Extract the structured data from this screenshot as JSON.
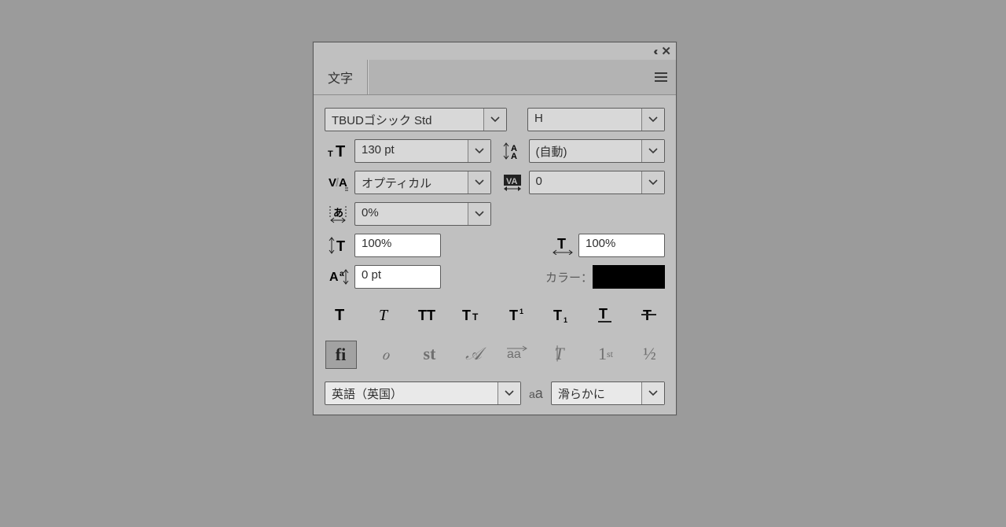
{
  "panel": {
    "tab_label": "文字",
    "font_family": "TBUDゴシック Std",
    "font_style": "H",
    "font_size": "130 pt",
    "leading": "(自動)",
    "kerning": "オプティカル",
    "tracking": "0",
    "tsume": "0%",
    "vscale": "100%",
    "hscale": "100%",
    "baseline": "0 pt",
    "color_label": "カラー：",
    "color_value": "#000000",
    "language": "英語（英国）",
    "antialias": "滑らかに",
    "icons": {
      "collapse": "‹‹",
      "close": "✕",
      "aa": "aa"
    },
    "ot_labels": {
      "ligature": "fi",
      "swash": "ℴ",
      "stylistic": "st",
      "titling": "𝒜",
      "contextual": "a͟a͟",
      "italic_orn": "𝑇",
      "ordinal": "1ˢᵗ",
      "fraction": "½"
    }
  }
}
